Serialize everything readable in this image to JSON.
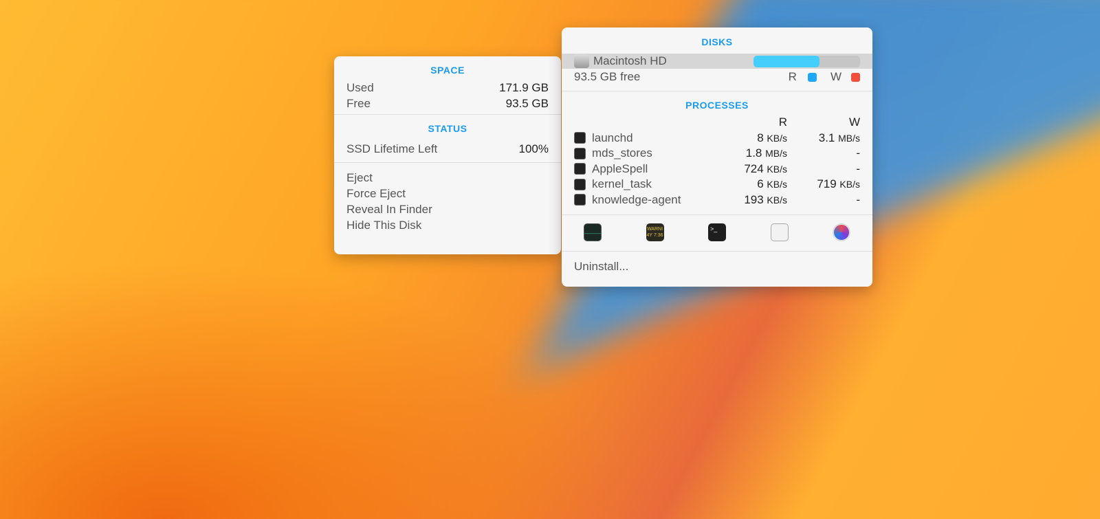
{
  "space_panel": {
    "space_header": "SPACE",
    "used_label": "Used",
    "used_value": "171.9 GB",
    "free_label": "Free",
    "free_value": "93.5 GB",
    "status_header": "STATUS",
    "ssd_label": "SSD Lifetime Left",
    "ssd_value": "100%",
    "actions": [
      "Eject",
      "Force Eject",
      "Reveal In Finder",
      "Hide This Disk"
    ]
  },
  "disks_panel": {
    "header": "DISKS",
    "disk": {
      "name": "Macintosh HD",
      "free": "93.5 GB free",
      "usage_fraction": 0.62,
      "read_label": "R",
      "write_label": "W",
      "usage_color": "#45cdfb",
      "read_color": "#1ea8f5",
      "write_color": "#f0503c"
    },
    "processes_header": "PROCESSES",
    "col_r": "R",
    "col_w": "W",
    "processes": [
      {
        "name": "launchd",
        "r": "8",
        "r_unit": "KB/s",
        "w": "3.1",
        "w_unit": "MB/s"
      },
      {
        "name": "mds_stores",
        "r": "1.8",
        "r_unit": "MB/s",
        "w": "-",
        "w_unit": ""
      },
      {
        "name": "AppleSpell",
        "r": "724",
        "r_unit": "KB/s",
        "w": "-",
        "w_unit": ""
      },
      {
        "name": "kernel_task",
        "r": "6",
        "r_unit": "KB/s",
        "w": "719",
        "w_unit": "KB/s"
      },
      {
        "name": "knowledge-agent",
        "r": "193",
        "r_unit": "KB/s",
        "w": "-",
        "w_unit": ""
      }
    ],
    "apps": [
      "activity-monitor-icon",
      "console-icon",
      "terminal-icon",
      "disk-utility-icon",
      "istat-icon"
    ],
    "console_text": "WARNI 4Y 7:36",
    "uninstall": "Uninstall..."
  }
}
